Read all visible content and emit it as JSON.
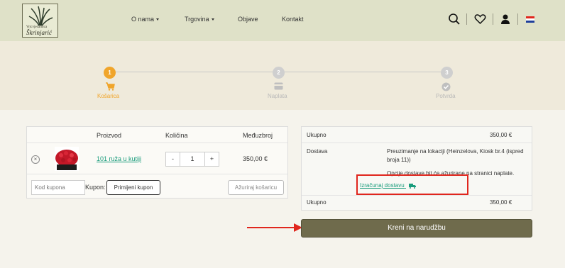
{
  "header": {
    "logo_small": "Vrtcvjećarnica",
    "logo_name": "Škrinjarić",
    "nav": [
      {
        "label": "O nama",
        "dropdown": true
      },
      {
        "label": "Trgovina",
        "dropdown": true
      },
      {
        "label": "Objave",
        "dropdown": false
      },
      {
        "label": "Kontakt",
        "dropdown": false
      }
    ],
    "icons": [
      "search-icon",
      "heart-icon",
      "user-icon",
      "croatian-flag-icon"
    ]
  },
  "steps": [
    {
      "number": "1",
      "label": "Košarica",
      "icon": "cart-icon",
      "active": true
    },
    {
      "number": "2",
      "label": "Naplata",
      "icon": "card-icon",
      "active": false
    },
    {
      "number": "3",
      "label": "Potvrda",
      "icon": "check-icon",
      "active": false
    }
  ],
  "cart": {
    "headers": {
      "product": "Proizvod",
      "quantity": "Količina",
      "subtotal": "Međuzbroj"
    },
    "items": [
      {
        "name": "101 ruža u kutiji",
        "quantity": "1",
        "subtotal": "350,00 €"
      }
    ],
    "qty_minus": "-",
    "qty_plus": "+",
    "remove_symbol": "×",
    "coupon_placeholder": "Kod kupona",
    "coupon_label": "Kupon:",
    "apply_coupon": "Primijeni kupon",
    "update_cart": "Ažuriraj košaricu"
  },
  "totals": {
    "subtotal_label": "Ukupno",
    "subtotal_value": "350,00 €",
    "shipping_label": "Dostava",
    "shipping_method": "Preuzimanje na lokaciji (Heinzelova, Kiosk br.4 (ispred broja 11))",
    "shipping_note": "Opcije dostave bit će ažurirane na stranici naplate.",
    "calculate_shipping": "Izračunaj dostavu",
    "total_label": "Ukupno",
    "total_value": "350,00 €"
  },
  "checkout_button": "Kreni na narudžbu",
  "colors": {
    "header_bg": "#dfe1c8",
    "accent_orange": "#f0a52b",
    "link_green": "#1a9c7c",
    "checkout_bg": "#6f6b4c",
    "highlight_red": "#e0261d"
  }
}
